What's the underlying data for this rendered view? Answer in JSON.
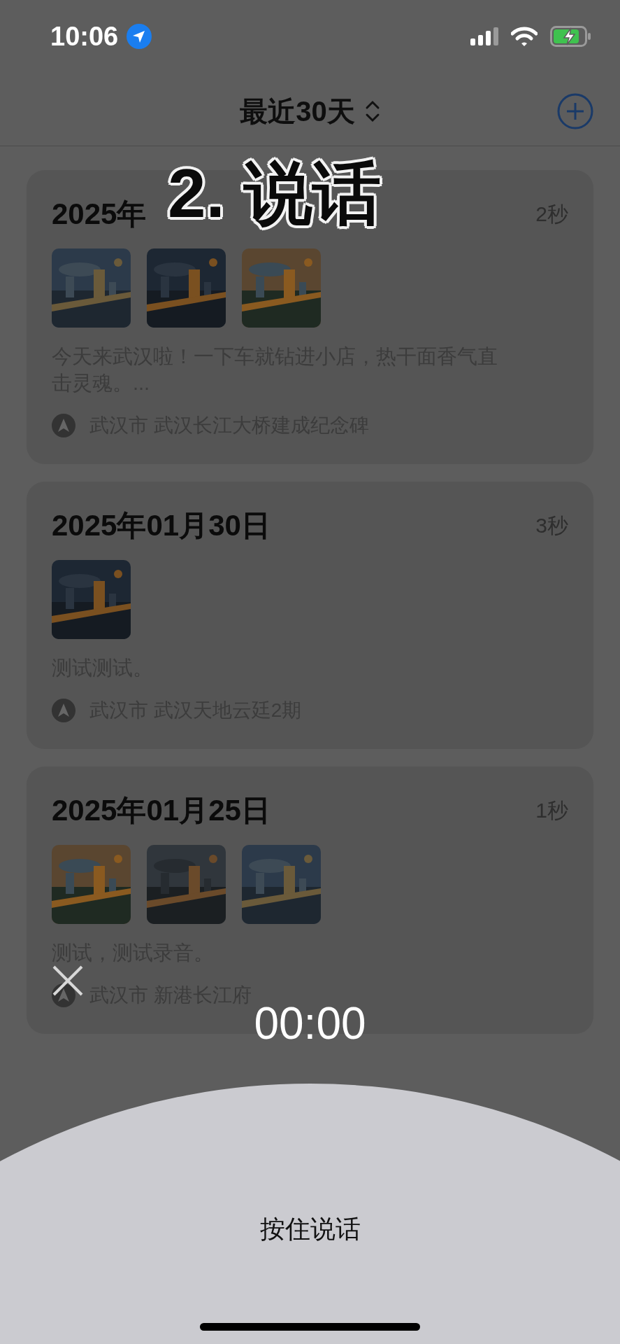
{
  "status_bar": {
    "time": "10:06"
  },
  "nav": {
    "title": "最近30天"
  },
  "caption": "2. 说话",
  "entries": [
    {
      "date": "2025年",
      "duration": "2秒",
      "text": "今天来武汉啦！一下车就钻进小店，热干面香气直击灵魂。...",
      "location": "武汉市 武汉长江大桥建成纪念碑"
    },
    {
      "date": "2025年01月30日",
      "duration": "3秒",
      "text": "测试测试。",
      "location": "武汉市 武汉天地云廷2期"
    },
    {
      "date": "2025年01月25日",
      "duration": "1秒",
      "text": "测试，测试录音。",
      "location": "武汉市 新港长江府"
    }
  ],
  "recorder": {
    "timer": "00:00",
    "hint": "按住说话"
  }
}
